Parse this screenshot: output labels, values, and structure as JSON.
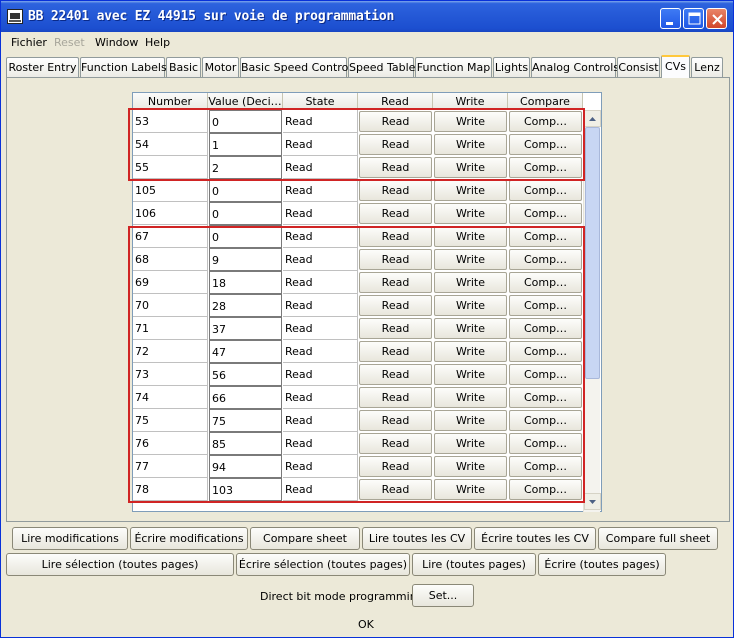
{
  "window": {
    "title": "BB 22401 avec EZ 44915 sur voie de programmation"
  },
  "menu": {
    "items": [
      "Fichier",
      "Reset",
      "Window",
      "Help"
    ]
  },
  "tabs": [
    "Roster Entry",
    "Function Labels",
    "Basic",
    "Motor",
    "Basic Speed Control",
    "Speed Table",
    "Function Map",
    "Lights",
    "Analog Controls",
    "Consist",
    "CVs",
    "Lenz"
  ],
  "active_tab": "CVs",
  "table": {
    "columns": [
      "Number",
      "Value (Deci…",
      "State",
      "Read",
      "Write",
      "Compare"
    ],
    "read_label": "Read",
    "write_label": "Write",
    "compare_label": "Comp…",
    "rows": [
      {
        "number": "53",
        "value": "0",
        "state": "Read"
      },
      {
        "number": "54",
        "value": "1",
        "state": "Read"
      },
      {
        "number": "55",
        "value": "2",
        "state": "Read"
      },
      {
        "number": "105",
        "value": "0",
        "state": "Read"
      },
      {
        "number": "106",
        "value": "0",
        "state": "Read"
      },
      {
        "number": "67",
        "value": "0",
        "state": "Read"
      },
      {
        "number": "68",
        "value": "9",
        "state": "Read"
      },
      {
        "number": "69",
        "value": "18",
        "state": "Read"
      },
      {
        "number": "70",
        "value": "28",
        "state": "Read"
      },
      {
        "number": "71",
        "value": "37",
        "state": "Read"
      },
      {
        "number": "72",
        "value": "47",
        "state": "Read"
      },
      {
        "number": "73",
        "value": "56",
        "state": "Read"
      },
      {
        "number": "74",
        "value": "66",
        "state": "Read"
      },
      {
        "number": "75",
        "value": "75",
        "state": "Read"
      },
      {
        "number": "76",
        "value": "85",
        "state": "Read"
      },
      {
        "number": "77",
        "value": "94",
        "state": "Read"
      },
      {
        "number": "78",
        "value": "103",
        "state": "Read"
      }
    ]
  },
  "buttons_row1": [
    "Lire modifications",
    "Écrire modifications",
    "Compare sheet",
    "Lire toutes les CV",
    "Écrire toutes les CV",
    "Compare full sheet"
  ],
  "buttons_row2": [
    "Lire sélection (toutes pages)",
    "Écrire sélection (toutes pages)",
    "Lire (toutes pages)",
    "Écrire (toutes pages)"
  ],
  "direct_bit": {
    "label": "Direct bit mode programming",
    "button": "Set..."
  },
  "status": "OK",
  "colors": {
    "titlebar": "#2458d6",
    "highlight": "#d02424",
    "tab_accent": "#ffc83c"
  }
}
